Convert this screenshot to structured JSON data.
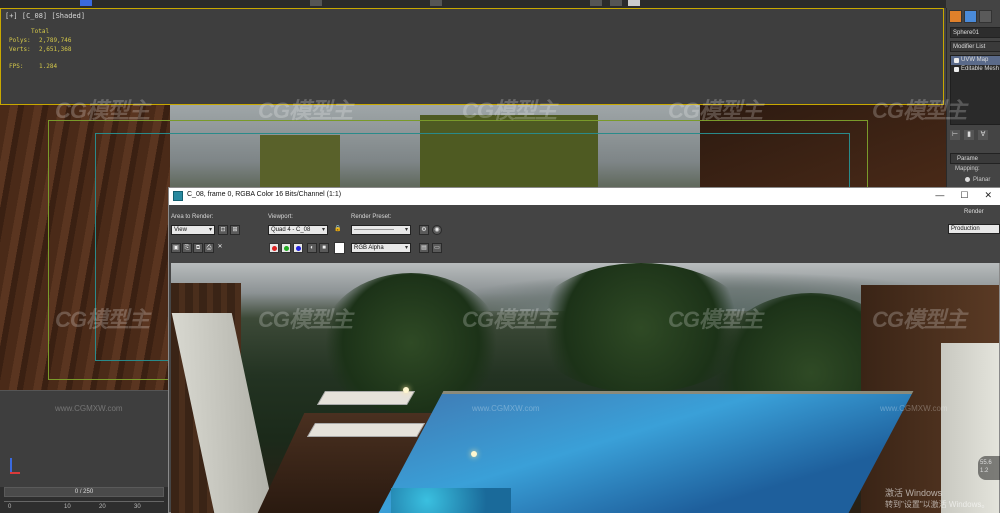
{
  "viewport_top": {
    "label": "[+] [C_08] [Shaded]",
    "stats": {
      "total_label": "Total",
      "polys_label": "Polys:",
      "polys_value": "2,789,746",
      "verts_label": "Verts:",
      "verts_value": "2,651,368",
      "fps_label": "FPS:",
      "fps_value": "1.284"
    }
  },
  "command_panel": {
    "object_name": "Sphere01",
    "modifier_list": "Modifier List",
    "stack": [
      "UVW Map",
      "Editable Mesh"
    ],
    "rollout_title": "Parame",
    "mappings_label": "Mapping:",
    "planar_label": "Planar"
  },
  "render_window": {
    "title": "C_08, frame 0, RGBA Color 16 Bits/Channel (1:1)",
    "area_label": "Area to Render:",
    "area_value": "View",
    "viewport_label": "Viewport:",
    "viewport_value": "Quad 4 - C_08",
    "preset_label": "Render Preset:",
    "preset_value": "--------------------",
    "channel_value": "RGB Alpha",
    "render_label": "Render",
    "render_mode": "Production",
    "coord_readout_1": "55.6",
    "coord_readout_2": "1.2"
  },
  "timeline": {
    "position": "0 / 250",
    "ticks": [
      "0",
      "10",
      "20",
      "30"
    ]
  },
  "watermark": {
    "brand": "CG模型主",
    "url": "www.CGMXW.com"
  },
  "system": {
    "activate_line1": "激活 Windows",
    "activate_line2": "转到\"设置\"以激活 Windows。"
  },
  "colors": {
    "viewport_border": "#c8a800",
    "stats_text": "#d4c84a",
    "active_tab": "#e0802a"
  }
}
